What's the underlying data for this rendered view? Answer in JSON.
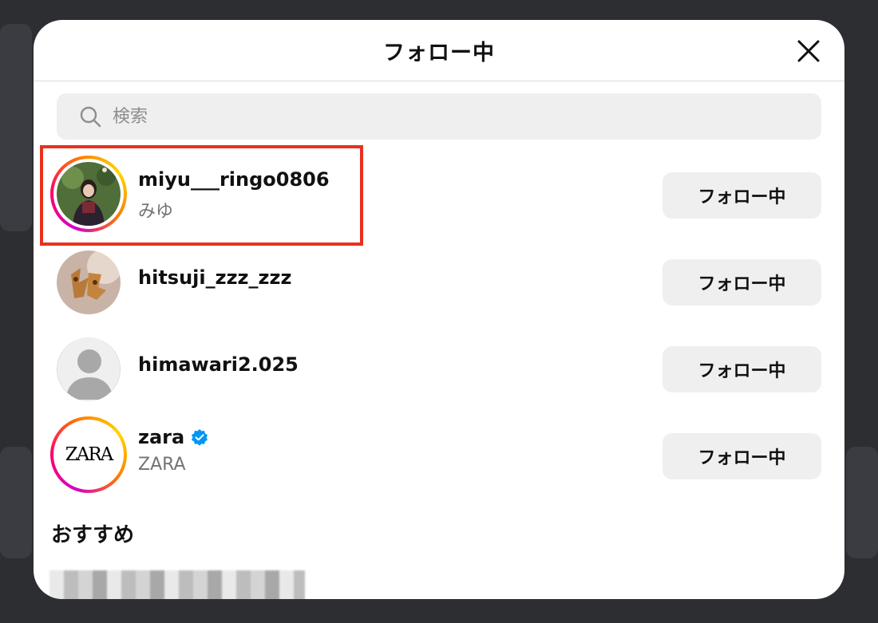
{
  "modal": {
    "title": "フォロー中",
    "search_placeholder": "検索",
    "section_recommended": "おすすめ"
  },
  "accounts": [
    {
      "username": "miyu___ringo0806",
      "fullname": "みゆ",
      "button": "フォロー中",
      "story_ring": true,
      "highlighted": true
    },
    {
      "username": "hitsuji_zzz_zzz",
      "fullname": "",
      "button": "フォロー中",
      "story_ring": false
    },
    {
      "username": "himawari2.025",
      "fullname": "",
      "button": "フォロー中",
      "story_ring": false,
      "default_avatar": true
    },
    {
      "username": "zara",
      "fullname": "ZARA",
      "button": "フォロー中",
      "story_ring": true,
      "verified": true,
      "avatar_text": "ZARA"
    }
  ],
  "colors": {
    "highlight_border": "#e8311d",
    "verified_badge": "#0095f6",
    "button_bg": "#efefef"
  }
}
